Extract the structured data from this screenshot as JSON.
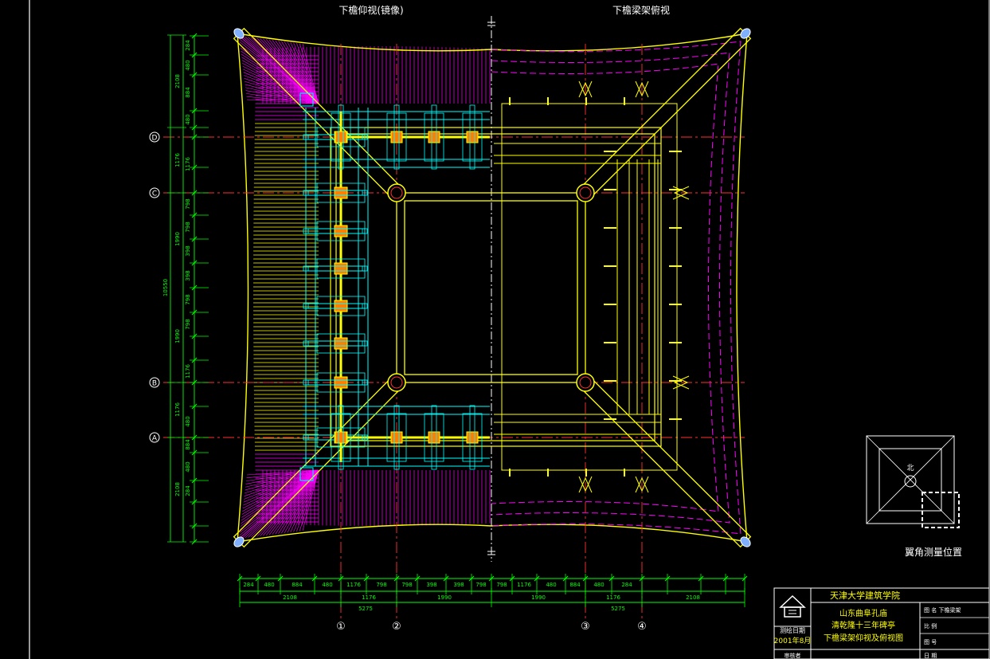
{
  "drawing": {
    "top_left_title": "下檐仰视(镜像)",
    "top_right_title": "下檐梁架俯视",
    "grid_rows": [
      "D",
      "C",
      "B",
      "A"
    ],
    "grid_cols": [
      "①",
      "②",
      "③",
      "④"
    ],
    "left_dims_outer": [
      "284",
      "480",
      "884",
      "480",
      "1176",
      "798",
      "798",
      "398",
      "398",
      "798",
      "798",
      "1176",
      "480",
      "884",
      "480",
      "284"
    ],
    "left_dims_mid": [
      "2108",
      "1176",
      "1990",
      "1990",
      "1176",
      "2108"
    ],
    "left_dims_total": "10550",
    "bottom_dims_outer": [
      "284",
      "480",
      "884",
      "480",
      "1176",
      "798",
      "798",
      "398",
      "398",
      "798",
      "798",
      "1176",
      "480",
      "884",
      "480",
      "284"
    ],
    "bottom_dims_mid": [
      "2108",
      "1176",
      "1990",
      "1990",
      "1176",
      "2108"
    ],
    "bottom_dims_total": [
      "5275",
      "5275"
    ],
    "keyplan_label": "翼角测量位置",
    "keyplan_mark": "北"
  },
  "title_block": {
    "institution": "天津大学建筑学院",
    "project_line1": "山东曲阜孔庙",
    "project_line2": "清乾隆十三年碑亭",
    "sheet_title": "下檐梁架仰视及俯视图",
    "date_label": "测绘日期",
    "date_value": "2001年8月",
    "row1": "图  名  下檐梁架",
    "row2": "比  例",
    "row3": "图  号",
    "row4": "日  期",
    "bottom_label": "审核者"
  },
  "colors": {
    "background": "#000000",
    "rafter": "#ff00ff",
    "timber": "#ffff00",
    "bracket": "#00ffff",
    "axis": "#ff3030",
    "dimension": "#00ff00",
    "frame": "#ffffff",
    "post": "#ff8000"
  }
}
